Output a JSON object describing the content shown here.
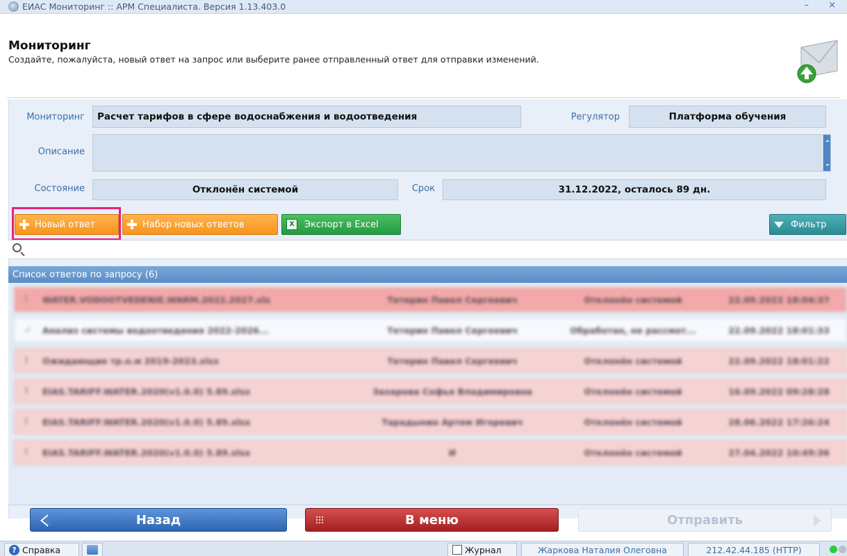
{
  "window": {
    "title": "ЕИАС Мониторинг :: АРМ Специалиста. Версия 1.13.403.0",
    "controls": "– ×"
  },
  "header": {
    "title": "Мониторинг",
    "subtitle": "Создайте, пожалуйста, новый ответ на запрос или выберите ранее отправленный ответ для отправки изменений."
  },
  "form": {
    "monitoring_label": "Мониторинг",
    "monitoring_value": "Расчет тарифов в сфере водоснабжения и водоотведения",
    "regulator_label": "Регулятор",
    "regulator_value": "Платформа обучения",
    "description_label": "Описание",
    "description_value": "",
    "state_label": "Состояние",
    "state_value": "Отклонён системой",
    "deadline_label": "Срок",
    "deadline_value": "31.12.2022, осталось 89 дн."
  },
  "toolbar": {
    "new_response": "Новый ответ",
    "new_responses_set": "Набор новых ответов",
    "export_excel": "Экспорт в Excel",
    "export_icon": "excel-icon",
    "filter": "Фильтр",
    "highlight_color": "#e6217f"
  },
  "search": {
    "placeholder": ""
  },
  "list": {
    "header": "Список ответов по запросу (6)",
    "rows": [
      {
        "name": "WATER.VODOOTVEDENIE.WARM.2022.2027.xls",
        "author": "Тетерин Павел Сергеевич",
        "status": "Отклонён системой",
        "date": "22.09.2022 18:04:37",
        "style": "red"
      },
      {
        "name": "Анализ системы водоотведения 2022-2026...",
        "author": "Тетерин Павел Сергеевич",
        "status": "Обработан, не рассмот...",
        "date": "22.09.2022 18:01:33",
        "style": "white"
      },
      {
        "name": "Ожидающие тр.о.м 2019-2023.xlsx",
        "author": "Тетерин Павел Сергеевич",
        "status": "Отклонён системой",
        "date": "22.09.2022 18:01:22",
        "style": "pink"
      },
      {
        "name": "EIAS.TARIFF.WATER.2020(v1.0.0) 5.89.xlsx",
        "author": "Захарова Софья Владимировна",
        "status": "Отклонён системой",
        "date": "16.09.2022 09:28:28",
        "style": "pink"
      },
      {
        "name": "EIAS.TARIFF.WATER.2020(v1.0.0) 5.89.xlsx",
        "author": "Тарадынин Артем Игоревич",
        "status": "Отклонён системой",
        "date": "28.06.2022 17:26:24",
        "style": "pink"
      },
      {
        "name": "EIAS.TARIFF.WATER.2020(v1.0.0) 5.89.xlsx",
        "author": "И",
        "status": "Отклонён системой",
        "date": "27.04.2022 10:49:36",
        "style": "pink"
      }
    ]
  },
  "nav": {
    "back": "Назад",
    "menu": "В меню",
    "send": "Отправить"
  },
  "statusbar": {
    "help": "Справка",
    "journal": "Журнал",
    "user": "Жаркова Наталия Олеговна",
    "server": "212.42.44.185 (HTTP)"
  },
  "colors": {
    "accent_blue": "#3a6ea5",
    "row_red": "#f3a9a9",
    "row_pink": "#f6d3d3",
    "status_ok": "#2ecc40"
  }
}
